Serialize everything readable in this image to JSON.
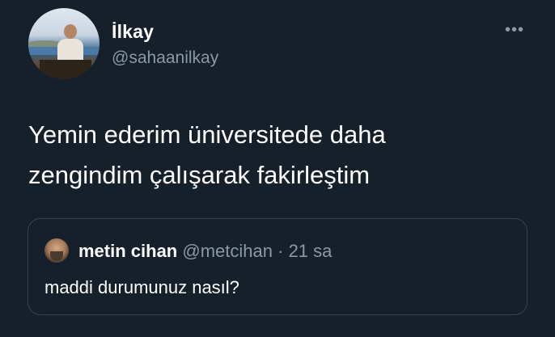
{
  "tweet": {
    "author_name": "İlkay",
    "author_handle": "@sahaanilkay",
    "more_icon": "•••",
    "text_lines": [
      "Yemin ederim üniversitede daha",
      "zengindim çalışarak fakirleştim"
    ]
  },
  "quoted_tweet": {
    "author_name": "metin cihan",
    "author_handle": "@metcihan",
    "separator": "·",
    "time": "21 sa",
    "text": "maddi durumunuz nasıl?"
  }
}
